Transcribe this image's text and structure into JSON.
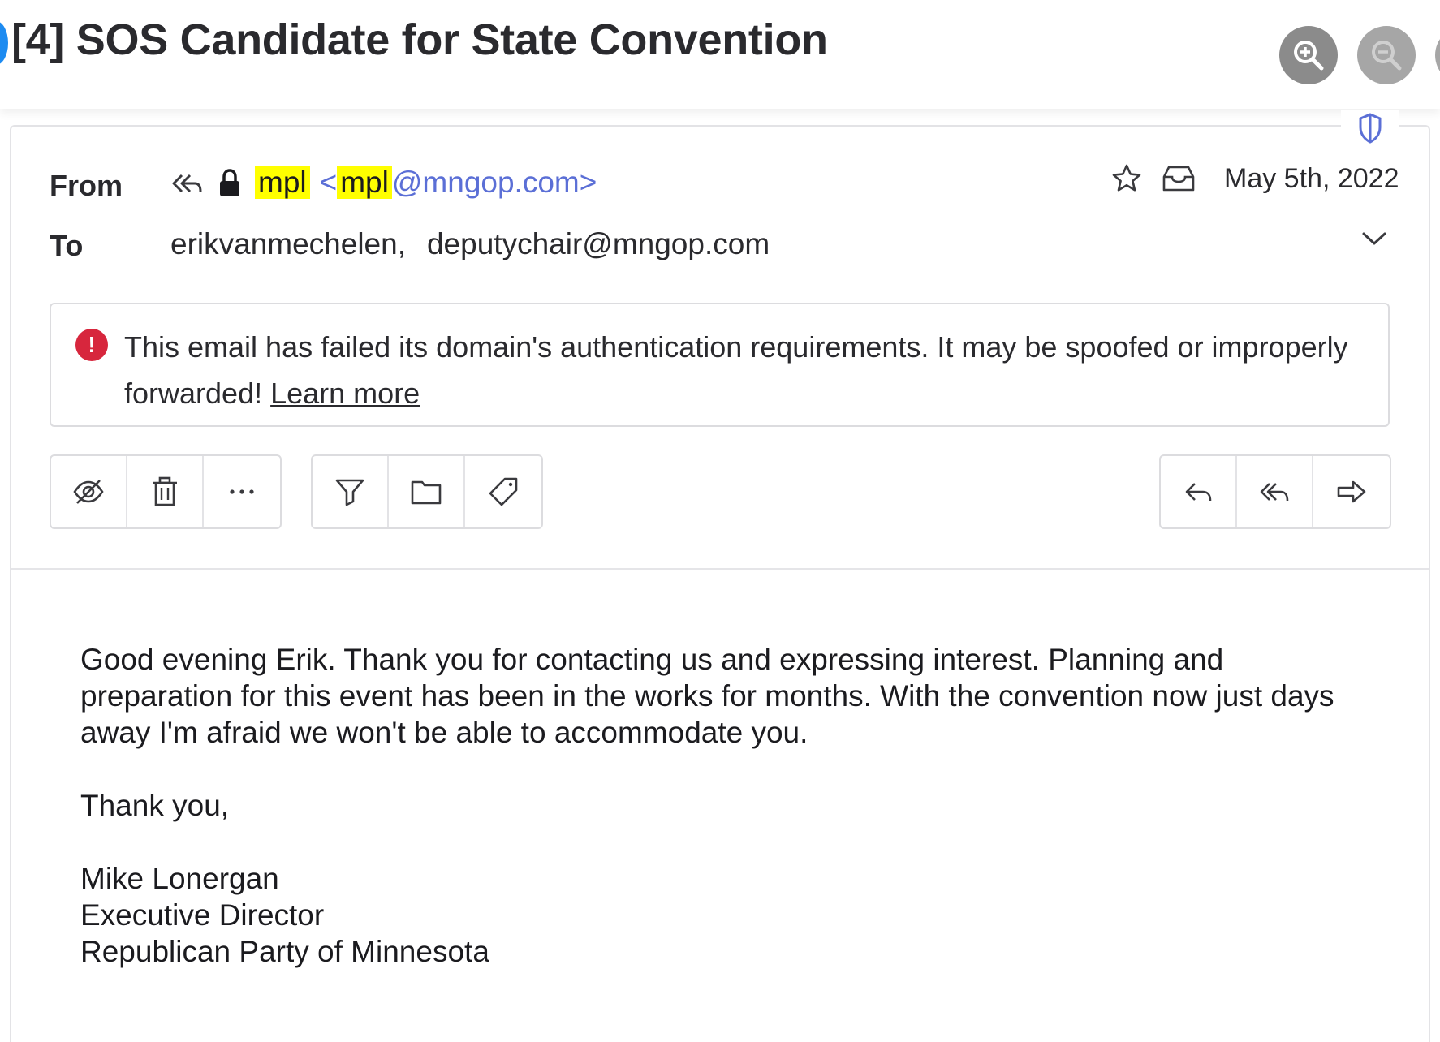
{
  "title_bar": {
    "title": "[4] SOS Candidate for State Convention",
    "zoom_in_icon": "zoom-in-icon",
    "zoom_out_icon": "zoom-out-icon"
  },
  "header": {
    "from_label": "From",
    "sender_name": "mpl",
    "sender_email_open": "<",
    "sender_email_user": "mpl",
    "sender_email_domain": "@mngop.com>",
    "to_label": "To",
    "recipients": [
      "erikvanmechelen,",
      "deputychair@mngop.com"
    ],
    "date": "May 5th, 2022"
  },
  "warning": {
    "text": "This email has failed its domain's authentication requirements. It may be spoofed or improperly forwarded!",
    "link": "Learn more",
    "color": "#d7263d"
  },
  "toolbar": {
    "left_group": [
      "hide-icon",
      "trash-icon",
      "more-icon"
    ],
    "middle_group": [
      "filter-icon",
      "folder-icon",
      "tag-icon"
    ],
    "right_group": [
      "reply-icon",
      "reply-all-icon",
      "forward-icon"
    ]
  },
  "body": {
    "paragraph": "Good evening Erik. Thank you for contacting us and expressing interest. Planning and preparation for this event has been in the works for months. With the convention now just days away I'm afraid we won't be able to accommodate you.",
    "closing": "Thank you,",
    "signature": [
      "Mike Lonergan",
      "Executive Director",
      "Republican Party of Minnesota"
    ]
  },
  "colors": {
    "highlight": "#ffff00",
    "link_blue": "#5b6fd6"
  }
}
